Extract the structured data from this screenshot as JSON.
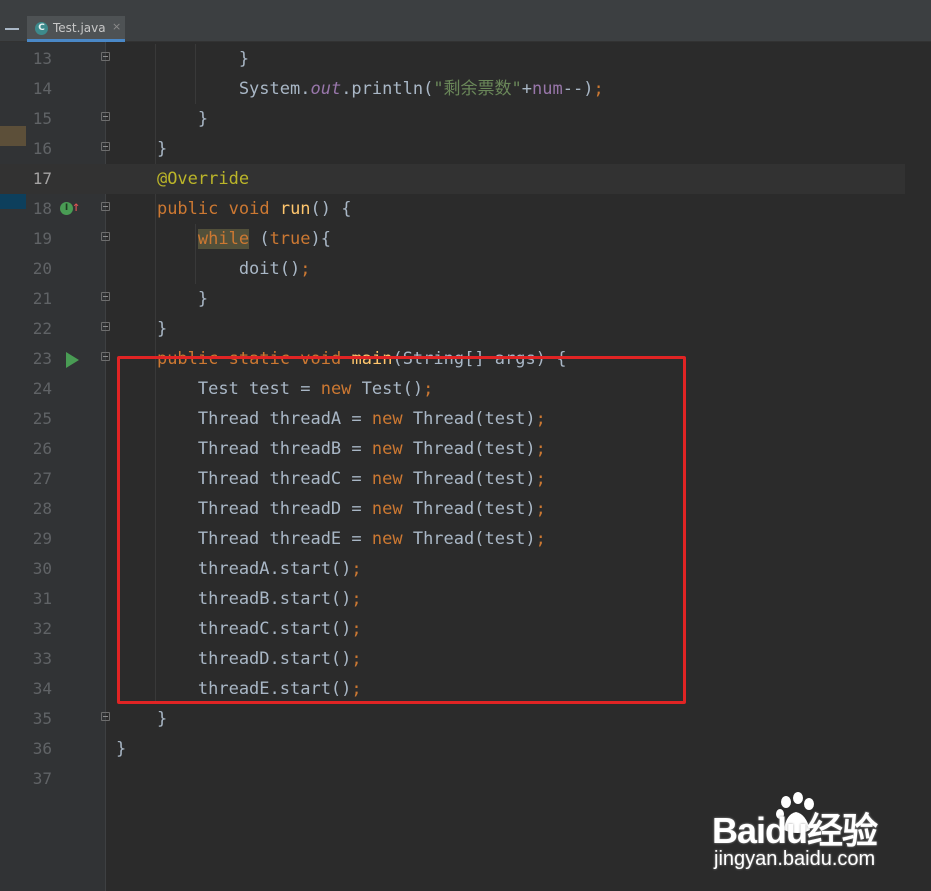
{
  "tab": {
    "file_name": "Test.java",
    "icon_letter": "C",
    "close_glyph": "×",
    "active_color": "#4a88c7"
  },
  "gutter_icons": {
    "implements_letter": "I",
    "implements_arrow": "↑"
  },
  "editor": {
    "current_line": 17,
    "highlight_box_color": "#e02424",
    "lines": [
      {
        "n": 13,
        "code": "            }"
      },
      {
        "n": 14,
        "code": "            System.out.println(\"剩余票数\"+num--);"
      },
      {
        "n": 15,
        "code": "        }"
      },
      {
        "n": 16,
        "code": "    }"
      },
      {
        "n": 17,
        "code": "    @Override"
      },
      {
        "n": 18,
        "code": "    public void run() {"
      },
      {
        "n": 19,
        "code": "        while (true){"
      },
      {
        "n": 20,
        "code": "            doit();"
      },
      {
        "n": 21,
        "code": "        }"
      },
      {
        "n": 22,
        "code": "    }"
      },
      {
        "n": 23,
        "code": "    public static void main(String[] args) {"
      },
      {
        "n": 24,
        "code": "        Test test = new Test();"
      },
      {
        "n": 25,
        "code": "        Thread threadA = new Thread(test);"
      },
      {
        "n": 26,
        "code": "        Thread threadB = new Thread(test);"
      },
      {
        "n": 27,
        "code": "        Thread threadC = new Thread(test);"
      },
      {
        "n": 28,
        "code": "        Thread threadD = new Thread(test);"
      },
      {
        "n": 29,
        "code": "        Thread threadE = new Thread(test);"
      },
      {
        "n": 30,
        "code": "        threadA.start();"
      },
      {
        "n": 31,
        "code": "        threadB.start();"
      },
      {
        "n": 32,
        "code": "        threadC.start();"
      },
      {
        "n": 33,
        "code": "        threadD.start();"
      },
      {
        "n": 34,
        "code": "        threadE.start();"
      },
      {
        "n": 35,
        "code": "    }"
      },
      {
        "n": 36,
        "code": "}"
      },
      {
        "n": 37,
        "code": ""
      }
    ]
  },
  "watermark": {
    "brand": "Baidu经验",
    "url": "jingyan.baidu.com"
  }
}
